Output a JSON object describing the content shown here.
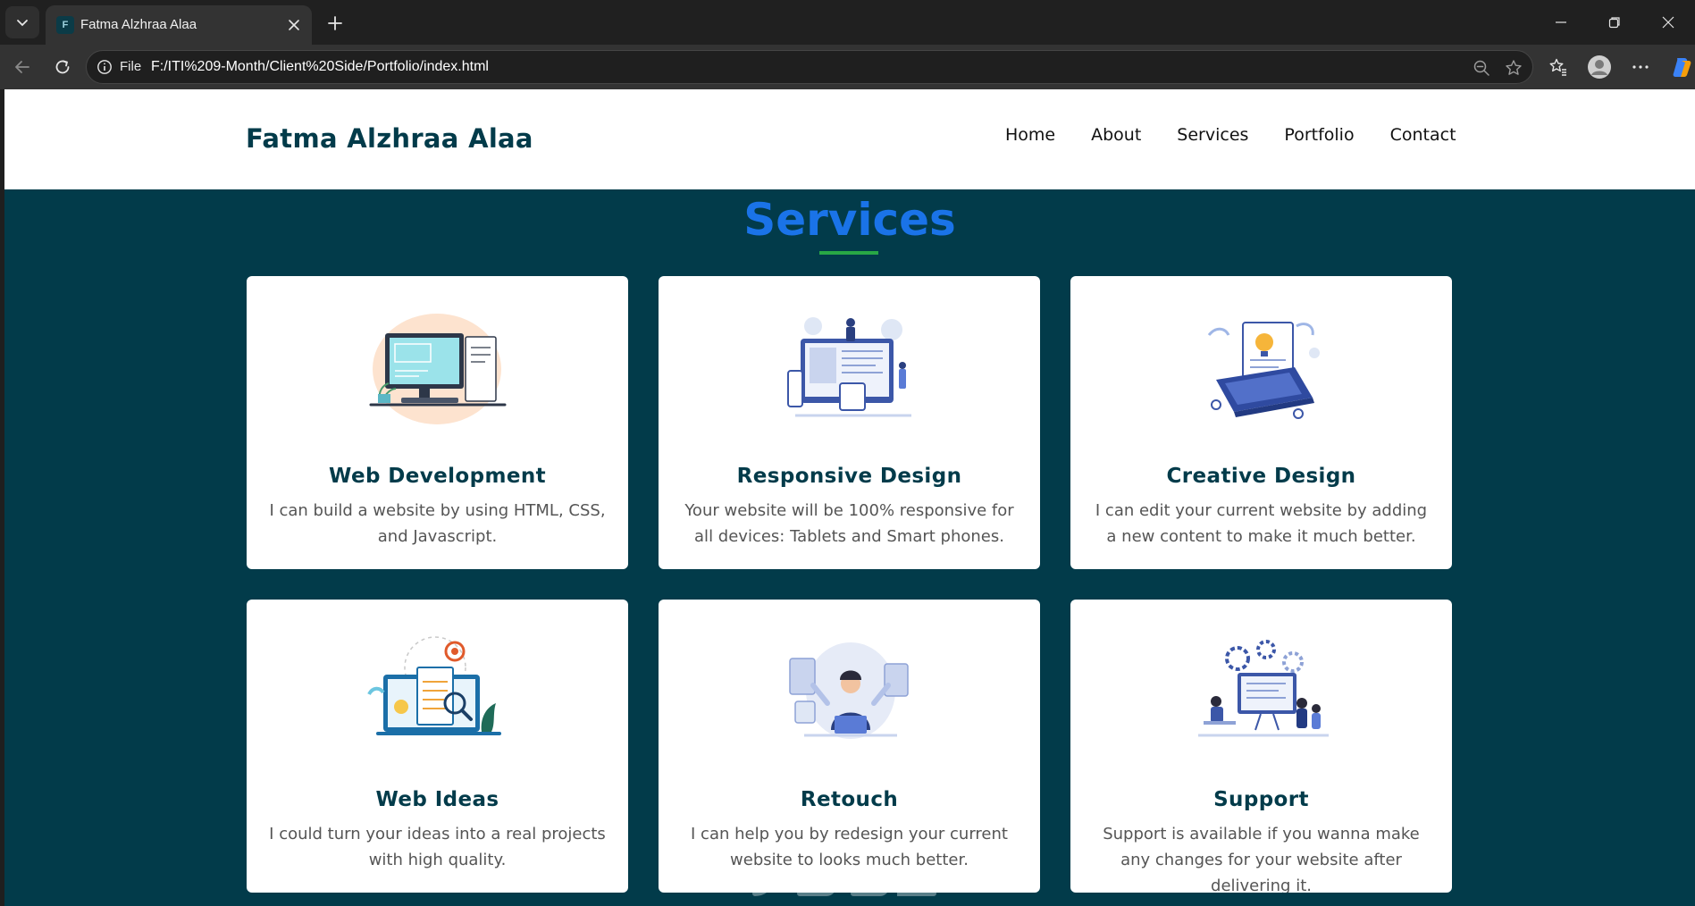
{
  "browser": {
    "tab_title": "Fatma Alzhraa Alaa",
    "tab_favicon_letter": "F",
    "address_scheme": "File",
    "address_url": "F:/ITI%209-Month/Client%20Side/Portfolio/index.html"
  },
  "site": {
    "brand": "Fatma Alzhraa Alaa",
    "nav": [
      "Home",
      "About",
      "Services",
      "Portfolio",
      "Contact"
    ],
    "section_title": "Services"
  },
  "services": [
    {
      "title": "Web Development",
      "description": "I can build a website by using HTML, CSS, and Javascript.",
      "illustration": "desktop-computer-icon"
    },
    {
      "title": "Responsive Design",
      "description": "Your website will be 100% responsive for all devices: Tablets and Smart phones.",
      "illustration": "responsive-devices-icon"
    },
    {
      "title": "Creative Design",
      "description": "I can edit your current website by adding a new content to make it much better.",
      "illustration": "laptop-idea-icon"
    },
    {
      "title": "Web Ideas",
      "description": "I could turn your ideas into a real projects with high quality.",
      "illustration": "idea-board-icon"
    },
    {
      "title": "Retouch",
      "description": "I can help you by redesign your current website to looks much better.",
      "illustration": "designer-retouch-icon"
    },
    {
      "title": "Support",
      "description": "Support is available if you wanna make any changes for your website after delivering it.",
      "illustration": "team-support-icon"
    }
  ],
  "colors": {
    "page_background": "#023b4a",
    "heading_blue": "#1a73e8",
    "underline_green": "#28a745",
    "card_title": "#023b4a"
  }
}
